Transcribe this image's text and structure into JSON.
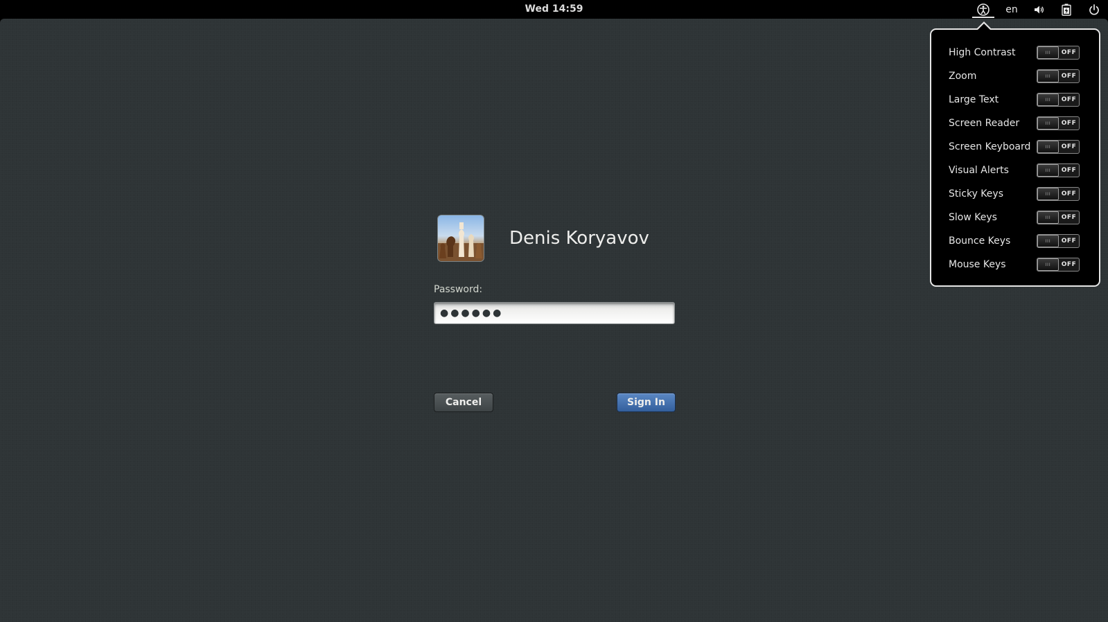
{
  "panel": {
    "clock": "Wed 14:59",
    "language": "en"
  },
  "login": {
    "user_name": "Denis Koryavov",
    "password_label": "Password:",
    "password_value": "●●●●●●",
    "cancel_label": "Cancel",
    "signin_label": "Sign In"
  },
  "a11y_menu": {
    "items": [
      {
        "label": "High Contrast",
        "state": "OFF"
      },
      {
        "label": "Zoom",
        "state": "OFF"
      },
      {
        "label": "Large Text",
        "state": "OFF"
      },
      {
        "label": "Screen Reader",
        "state": "OFF"
      },
      {
        "label": "Screen Keyboard",
        "state": "OFF"
      },
      {
        "label": "Visual Alerts",
        "state": "OFF"
      },
      {
        "label": "Sticky Keys",
        "state": "OFF"
      },
      {
        "label": "Slow Keys",
        "state": "OFF"
      },
      {
        "label": "Bounce Keys",
        "state": "OFF"
      },
      {
        "label": "Mouse Keys",
        "state": "OFF"
      }
    ]
  },
  "icons": {
    "accessibility": "accessibility-icon",
    "volume": "volume-icon",
    "battery": "battery-icon",
    "power": "power-icon",
    "avatar": "chess-pieces-avatar"
  },
  "colors": {
    "background": "#2e3436",
    "panel": "#000000",
    "signin_button": "#3d6aa8",
    "text": "#eeeeec"
  }
}
